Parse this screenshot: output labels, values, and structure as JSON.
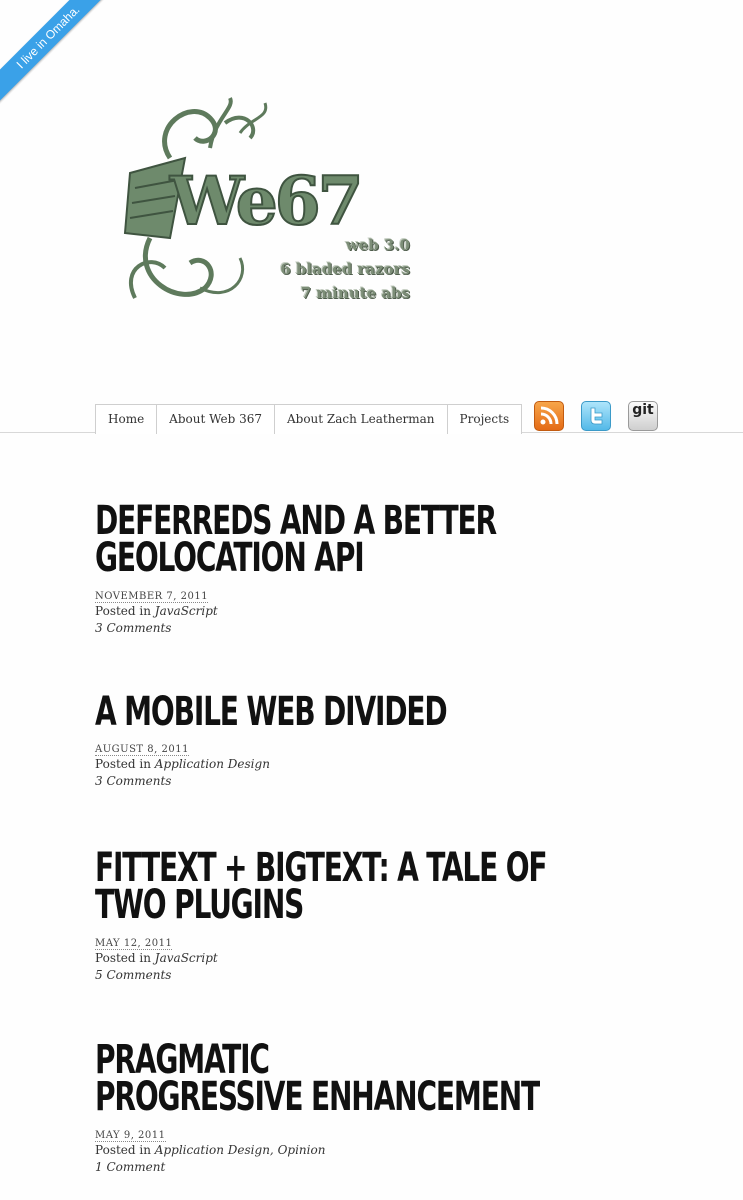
{
  "ribbon": {
    "label": "I live in Omaha."
  },
  "logo": {
    "wordmark": "We67",
    "tagline": [
      "web 3.0",
      "6 bladed razors",
      "7 minute abs"
    ],
    "color": "#6e8a6c"
  },
  "nav": {
    "items": [
      "Home",
      "About Web 367",
      "About Zach Leatherman",
      "Projects"
    ]
  },
  "social": {
    "git_label": "git"
  },
  "posts": [
    {
      "title_line1": "DEFERREDS AND A BETTER",
      "title_line2": "GEOLOCATION API",
      "date": "November 7, 2011",
      "posted_in": "Posted in",
      "categories": "JavaScript",
      "comments": "3 Comments"
    },
    {
      "title_line1": "A MOBILE WEB DIVIDED",
      "title_line2": "",
      "date": "August 8, 2011",
      "posted_in": "Posted in",
      "categories": "Application Design",
      "comments": "3 Comments"
    },
    {
      "title_line1": "FITTEXT + BIGTEXT: A TALE OF",
      "title_line2": "TWO PLUGINS",
      "date": "May 12, 2011",
      "posted_in": "Posted in",
      "categories": "JavaScript",
      "comments": "5 Comments"
    },
    {
      "title_line1": "PRAGMATIC",
      "title_line2": "PROGRESSIVE ENHANCEMENT",
      "date": "May 9, 2011",
      "posted_in": "Posted in",
      "categories": "Application Design, Opinion",
      "comments": "1 Comment"
    }
  ]
}
